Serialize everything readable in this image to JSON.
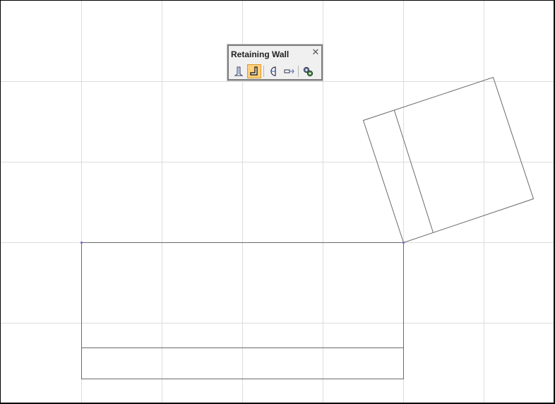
{
  "toolbar": {
    "title": "Retaining Wall",
    "close_icon": "close-icon",
    "buttons": [
      {
        "name": "wall-elevation-icon",
        "active": false
      },
      {
        "name": "wall-profile-icon",
        "active": true
      },
      {
        "name": "half-circle-end-icon",
        "active": false
      },
      {
        "name": "extend-arrow-icon",
        "active": false
      },
      {
        "name": "settings-gears-icon",
        "active": false
      }
    ]
  },
  "colors": {
    "background": "#ffffff",
    "grid": "#dddddd",
    "geometry": "#6a6a6a",
    "vertex": "#8a66c8",
    "active_button": "#ffcf7a"
  }
}
